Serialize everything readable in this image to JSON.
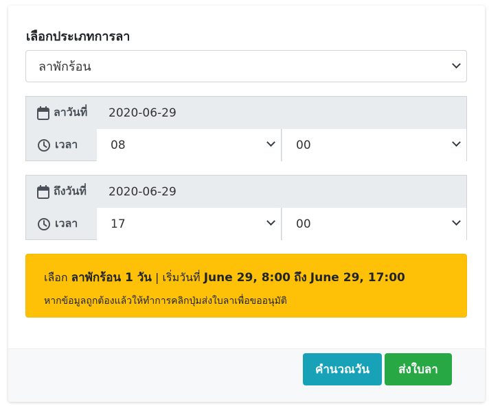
{
  "form": {
    "leave_type_label": "เลือกประเภทการลา",
    "leave_type_value": "ลาพักร้อน"
  },
  "start": {
    "date_label": "ลาวันที่",
    "date_value": "2020-06-29",
    "time_label": "เวลา",
    "hour": "08",
    "minute": "00"
  },
  "end": {
    "date_label": "ถึงวันที่",
    "date_value": "2020-06-29",
    "time_label": "เวลา",
    "hour": "17",
    "minute": "00"
  },
  "summary": {
    "prefix": "เลือก",
    "leave_desc": "ลาพักร้อน 1 วัน",
    "separator": "|",
    "start_prefix": "เริ่มวันที่",
    "start_at": "June 29, 8:00",
    "to_word": "ถึง",
    "end_at": "June 29, 17:00",
    "note": "หากข้อมูลถูกต้องแล้วให้ทำการคลิกปุ่มส่งใบลาเพื่อขออนุมัติ"
  },
  "buttons": {
    "calculate": "คำนวณวัน",
    "submit": "ส่งใบลา"
  },
  "colors": {
    "alert_bg": "#ffc107",
    "calculate_bg": "#17a2b8",
    "submit_bg": "#28a745"
  },
  "icons": {
    "date": "calendar-icon",
    "time": "clock-icon"
  }
}
